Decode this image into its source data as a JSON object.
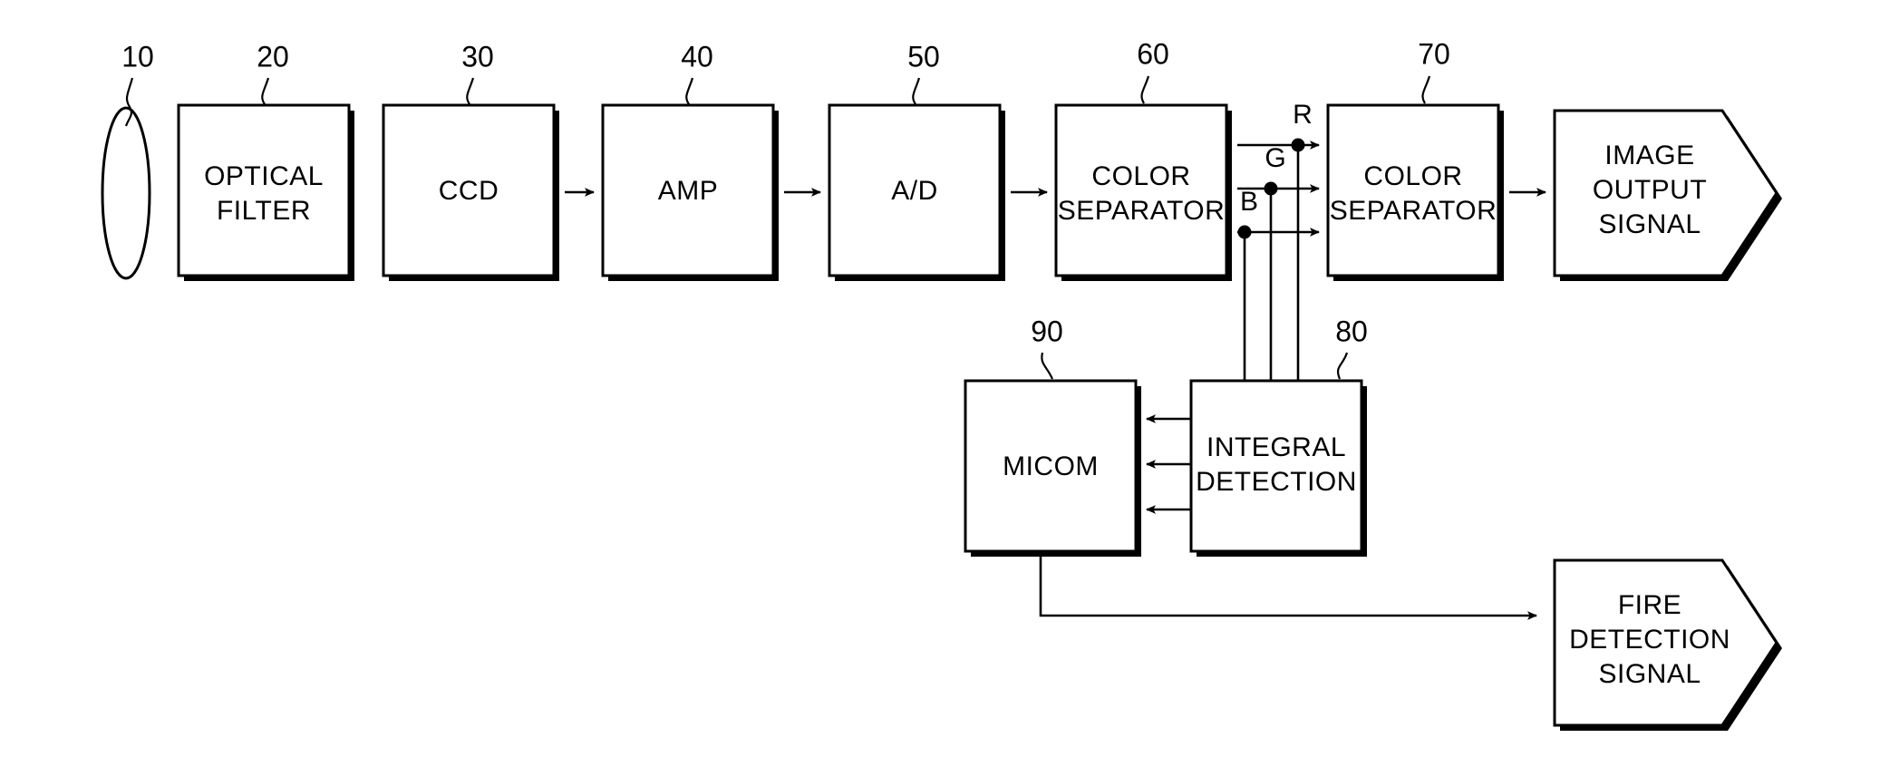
{
  "figure": {
    "type": "block-diagram",
    "title": "",
    "background_color": "#ffffff",
    "line_color": "#000000"
  },
  "blocks": [
    {
      "id": "lens",
      "ref": "10",
      "shape": "ellipse",
      "label_lines": []
    },
    {
      "id": "opt_filter",
      "ref": "20",
      "shape": "rect",
      "label_lines": [
        "OPTICAL",
        "FILTER"
      ]
    },
    {
      "id": "ccd",
      "ref": "30",
      "shape": "rect",
      "label_lines": [
        "CCD"
      ]
    },
    {
      "id": "amp",
      "ref": "40",
      "shape": "rect",
      "label_lines": [
        "AMP"
      ]
    },
    {
      "id": "adc",
      "ref": "50",
      "shape": "rect",
      "label_lines": [
        "A/D"
      ]
    },
    {
      "id": "colorsep1",
      "ref": "60",
      "shape": "rect",
      "label_lines": [
        "COLOR",
        "SEPARATOR"
      ]
    },
    {
      "id": "colorsep2",
      "ref": "70",
      "shape": "rect",
      "label_lines": [
        "COLOR",
        "SEPARATOR"
      ]
    },
    {
      "id": "integral",
      "ref": "80",
      "shape": "rect",
      "label_lines": [
        "INTEGRAL",
        "DETECTION"
      ]
    },
    {
      "id": "micom",
      "ref": "90",
      "shape": "rect",
      "label_lines": [
        "MICOM"
      ]
    },
    {
      "id": "img_out",
      "ref": "",
      "shape": "pentagon-arrow",
      "label_lines": [
        "IMAGE",
        "OUTPUT",
        "SIGNAL"
      ]
    },
    {
      "id": "fire_out",
      "ref": "",
      "shape": "pentagon-arrow",
      "label_lines": [
        "FIRE",
        "DETECTION",
        "SIGNAL"
      ]
    }
  ],
  "signal_labels": {
    "r": "R",
    "g": "G",
    "b": "B"
  },
  "reference_numerals": [
    "10",
    "20",
    "30",
    "40",
    "50",
    "60",
    "70",
    "80",
    "90"
  ],
  "block_text": {
    "optical_filter_l1": "OPTICAL",
    "optical_filter_l2": "FILTER",
    "ccd": "CCD",
    "amp": "AMP",
    "adc": "A/D",
    "colorsep1_l1": "COLOR",
    "colorsep1_l2": "SEPARATOR",
    "colorsep2_l1": "COLOR",
    "colorsep2_l2": "SEPARATOR",
    "integral_l1": "INTEGRAL",
    "integral_l2": "DETECTION",
    "micom": "MICOM",
    "image_output_l1": "IMAGE",
    "image_output_l2": "OUTPUT",
    "image_output_l3": "SIGNAL",
    "fire_detection_l1": "FIRE",
    "fire_detection_l2": "DETECTION",
    "fire_detection_l3": "SIGNAL"
  },
  "ref_text": {
    "n10": "10",
    "n20": "20",
    "n30": "30",
    "n40": "40",
    "n50": "50",
    "n60": "60",
    "n70": "70",
    "n80": "80",
    "n90": "90"
  },
  "connections": [
    {
      "from": "ccd",
      "to": "amp",
      "style": "arrow"
    },
    {
      "from": "amp",
      "to": "adc",
      "style": "arrow"
    },
    {
      "from": "adc",
      "to": "colorsep1",
      "style": "arrow"
    },
    {
      "from": "colorsep1",
      "to": "colorsep2",
      "style": "arrow",
      "signal": "R"
    },
    {
      "from": "colorsep1",
      "to": "colorsep2",
      "style": "arrow",
      "signal": "G"
    },
    {
      "from": "colorsep1",
      "to": "colorsep2",
      "style": "arrow",
      "signal": "B"
    },
    {
      "from": "colorsep2",
      "to": "img_out",
      "style": "arrow"
    },
    {
      "from": "R-tap",
      "to": "integral",
      "style": "line"
    },
    {
      "from": "G-tap",
      "to": "integral",
      "style": "line"
    },
    {
      "from": "B-tap",
      "to": "integral",
      "style": "line"
    },
    {
      "from": "integral",
      "to": "micom",
      "style": "arrow"
    },
    {
      "from": "integral",
      "to": "micom",
      "style": "arrow"
    },
    {
      "from": "integral",
      "to": "micom",
      "style": "arrow"
    },
    {
      "from": "micom",
      "to": "fire_out",
      "style": "arrow"
    }
  ]
}
